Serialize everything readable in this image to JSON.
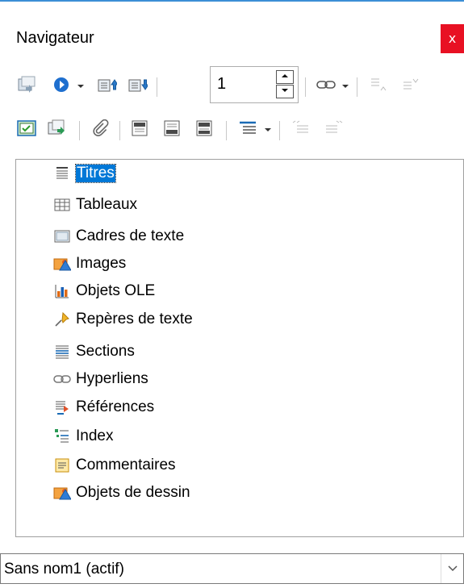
{
  "window": {
    "title": "Navigateur",
    "close_label": "x"
  },
  "toolbar1": {
    "buttons": [
      {
        "icon": "toggle-icon"
      },
      {
        "icon": "navigation-icon"
      },
      {
        "icon": "chevron-down-icon"
      },
      {
        "icon": "previous-icon"
      },
      {
        "icon": "next-icon"
      },
      {
        "icon": "hyperlink-icon"
      },
      {
        "icon": "chevron-down-icon"
      },
      {
        "icon": "promote-level-icon"
      },
      {
        "icon": "demote-level-icon"
      }
    ],
    "page_number": "1"
  },
  "toolbar2": {
    "buttons": [
      {
        "icon": "content-view-icon"
      },
      {
        "icon": "set-reminder-icon"
      },
      {
        "icon": "drag-mode-icon"
      },
      {
        "icon": "header-icon"
      },
      {
        "icon": "footer-icon"
      },
      {
        "icon": "anchor-icon"
      },
      {
        "icon": "heading-levels-icon"
      },
      {
        "icon": "chevron-down-icon"
      },
      {
        "icon": "promote-chapter-icon"
      },
      {
        "icon": "demote-chapter-icon"
      }
    ]
  },
  "tree": {
    "items": [
      {
        "label": "Titres",
        "icon": "headings-icon",
        "selected": true
      },
      {
        "label": "Tableaux",
        "icon": "table-icon"
      },
      {
        "label": "Cadres de texte",
        "icon": "text-frame-icon"
      },
      {
        "label": "Images",
        "icon": "image-icon"
      },
      {
        "label": "Objets OLE",
        "icon": "ole-object-icon"
      },
      {
        "label": "Repères de texte",
        "icon": "bookmark-icon"
      },
      {
        "label": "Sections",
        "icon": "section-icon"
      },
      {
        "label": "Hyperliens",
        "icon": "hyperlink-icon"
      },
      {
        "label": "Références",
        "icon": "reference-icon"
      },
      {
        "label": "Index",
        "icon": "index-icon"
      },
      {
        "label": "Commentaires",
        "icon": "comment-icon"
      },
      {
        "label": "Objets de dessin",
        "icon": "drawing-object-icon"
      }
    ]
  },
  "document_select": {
    "value": "Sans nom1 (actif)"
  },
  "colors": {
    "accent": "#3c8fd6",
    "close": "#e81123",
    "selection": "#0078d7"
  }
}
